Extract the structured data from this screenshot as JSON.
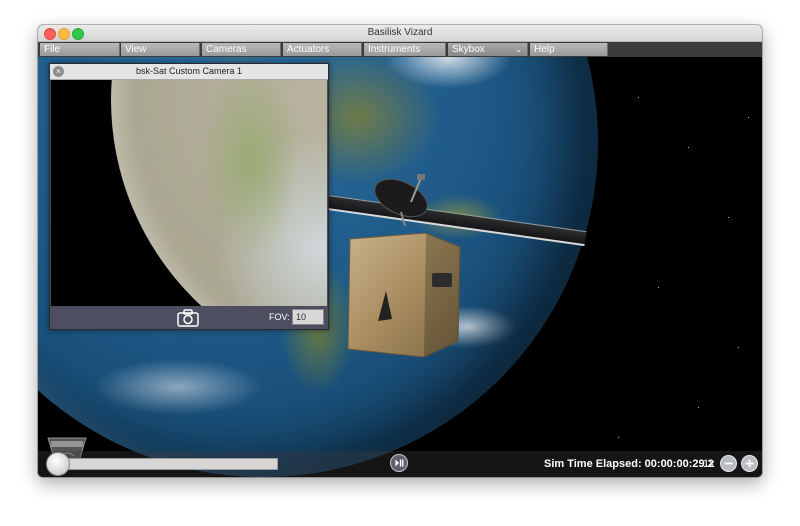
{
  "window": {
    "title": "Basilisk Vizard"
  },
  "menu": [
    {
      "label": "File"
    },
    {
      "label": "View"
    },
    {
      "label": "Cameras"
    },
    {
      "label": "Actuators"
    },
    {
      "label": "Instruments"
    },
    {
      "label": "Skybox"
    },
    {
      "label": "Help"
    }
  ],
  "camera_panel": {
    "title": "bsk-Sat Custom Camera 1",
    "fov_label": "FOV:",
    "fov_value": "10"
  },
  "playback": {
    "progress": 0.02,
    "sim_time": "Sim Time Elapsed: 00:00:00:29.2",
    "speed": "1x"
  },
  "icons": {
    "close": "close-icon",
    "camera": "camera-icon",
    "play_pause": "play-pause-icon",
    "zoom_out": "minus-icon",
    "zoom_in": "plus-icon",
    "dropdown": "chevron-down-icon"
  }
}
